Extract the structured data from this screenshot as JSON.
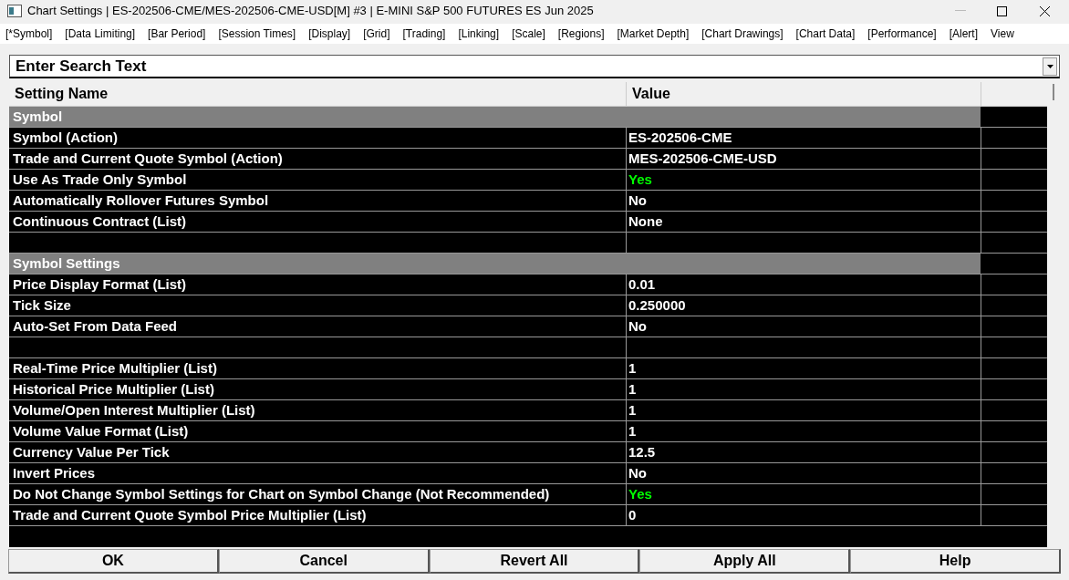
{
  "window": {
    "title": "Chart Settings | ES-202506-CME/MES-202506-CME-USD[M] #3 | E-MINI S&P 500 FUTURES ES Jun 2025"
  },
  "menu": [
    "[*Symbol]",
    "[Data Limiting]",
    "[Bar Period]",
    "[Session Times]",
    "[Display]",
    "[Grid]",
    "[Trading]",
    "[Linking]",
    "[Scale]",
    "[Regions]",
    "[Market Depth]",
    "[Chart Drawings]",
    "[Chart Data]",
    "[Performance]",
    "[Alert]",
    "View"
  ],
  "search": {
    "placeholder": "Enter Search Text"
  },
  "table": {
    "columns": [
      "Setting Name",
      "Value"
    ],
    "rows": [
      {
        "kind": "section",
        "name": "Symbol"
      },
      {
        "kind": "setting",
        "name": "Symbol (Action)",
        "value": "ES-202506-CME",
        "color": "#ffffff"
      },
      {
        "kind": "setting",
        "name": "Trade and Current Quote Symbol (Action)",
        "value": "MES-202506-CME-USD",
        "color": "#ffffff"
      },
      {
        "kind": "setting",
        "name": "Use As Trade Only Symbol",
        "value": "Yes",
        "color": "#00ff00"
      },
      {
        "kind": "setting",
        "name": "Automatically Rollover Futures Symbol",
        "value": "No",
        "color": "#ffffff"
      },
      {
        "kind": "setting",
        "name": "Continuous Contract (List)",
        "value": "None",
        "color": "#ffffff"
      },
      {
        "kind": "blank"
      },
      {
        "kind": "section",
        "name": "Symbol Settings"
      },
      {
        "kind": "setting",
        "name": "Price Display Format (List)",
        "value": "0.01",
        "color": "#ffffff"
      },
      {
        "kind": "setting",
        "name": "Tick Size",
        "value": "0.250000",
        "color": "#ffffff"
      },
      {
        "kind": "setting",
        "name": "Auto-Set From Data Feed",
        "value": "No",
        "color": "#ffffff"
      },
      {
        "kind": "blank"
      },
      {
        "kind": "setting",
        "name": "Real-Time Price Multiplier (List)",
        "value": "1",
        "color": "#ffffff"
      },
      {
        "kind": "setting",
        "name": "Historical Price Multiplier (List)",
        "value": "1",
        "color": "#ffffff"
      },
      {
        "kind": "setting",
        "name": "Volume/Open Interest Multiplier (List)",
        "value": "1",
        "color": "#ffffff"
      },
      {
        "kind": "setting",
        "name": "Volume Value Format (List)",
        "value": "1",
        "color": "#ffffff"
      },
      {
        "kind": "setting",
        "name": "Currency Value Per Tick",
        "value": "12.5",
        "color": "#ffffff"
      },
      {
        "kind": "setting",
        "name": "Invert Prices",
        "value": "No",
        "color": "#ffffff"
      },
      {
        "kind": "setting",
        "name": "Do Not Change Symbol Settings for Chart on Symbol Change (Not Recommended)",
        "value": "Yes",
        "color": "#00ff00"
      },
      {
        "kind": "setting",
        "name": "Trade and Current Quote Symbol Price Multiplier (List)",
        "value": "0",
        "color": "#ffffff"
      }
    ]
  },
  "buttons": [
    "OK",
    "Cancel",
    "Revert All",
    "Apply All",
    "Help"
  ]
}
